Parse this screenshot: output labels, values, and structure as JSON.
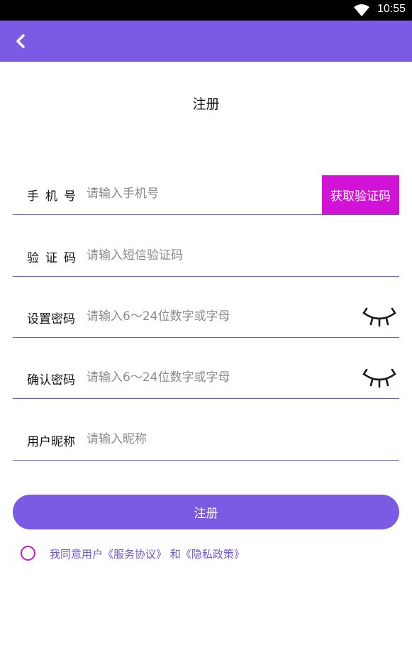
{
  "status_bar": {
    "time": "10:55",
    "wifi_icon": "wifi-icon"
  },
  "app_bar": {
    "back_icon": "chevron-left-icon",
    "color": "#7b5be3"
  },
  "page_title": "注册",
  "form": {
    "phone": {
      "label": "手机号",
      "placeholder": "请输入手机号",
      "get_code_label": "获取验证码"
    },
    "code": {
      "label": "验证码",
      "placeholder": "请输入短信验证码"
    },
    "password": {
      "label": "设置密码",
      "placeholder": "请输入6～24位数字或字母",
      "eye_icon": "eye-closed-icon"
    },
    "confirm_password": {
      "label": "确认密码",
      "placeholder": "请输入6～24位数字或字母",
      "eye_icon": "eye-closed-icon"
    },
    "nickname": {
      "label": "用户昵称",
      "placeholder": "请输入昵称"
    }
  },
  "submit_label": "注册",
  "agreement": {
    "prefix": "我同意用户",
    "service_link": "《服务协议》",
    "middle": " 和",
    "privacy_link": "《隐私政策》"
  },
  "colors": {
    "primary": "#7b5be3",
    "accent": "#d312d8",
    "underline": "#6a58d8"
  }
}
